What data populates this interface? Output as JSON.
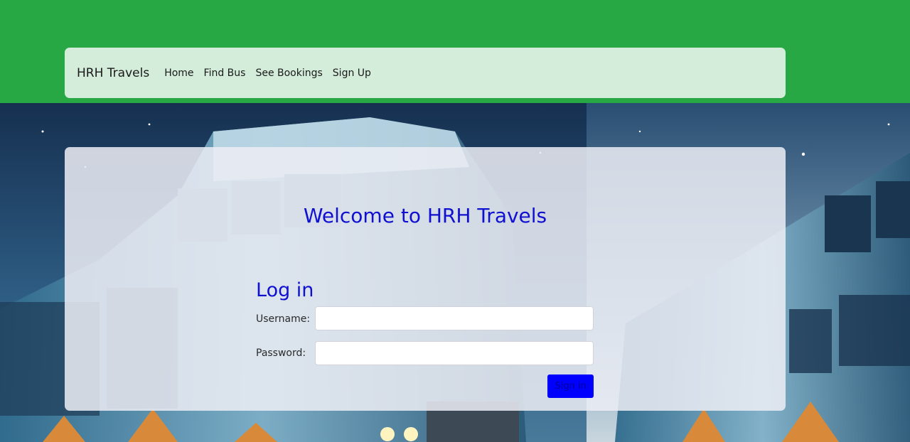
{
  "nav": {
    "brand": "HRH Travels",
    "links": [
      {
        "label": "Home"
      },
      {
        "label": "Find Bus"
      },
      {
        "label": "See Bookings"
      },
      {
        "label": "Sign Up"
      }
    ]
  },
  "card": {
    "welcome": "Welcome to HRH Travels",
    "login_title": "Log in",
    "username_label": "Username:",
    "password_label": "Password:",
    "username_value": "",
    "password_value": "",
    "signin_label": "Sign in"
  },
  "colors": {
    "header_green": "#28a745",
    "navbar_bg": "#d4edda",
    "heading_blue": "#1010d0",
    "button_blue": "#0000ff"
  }
}
